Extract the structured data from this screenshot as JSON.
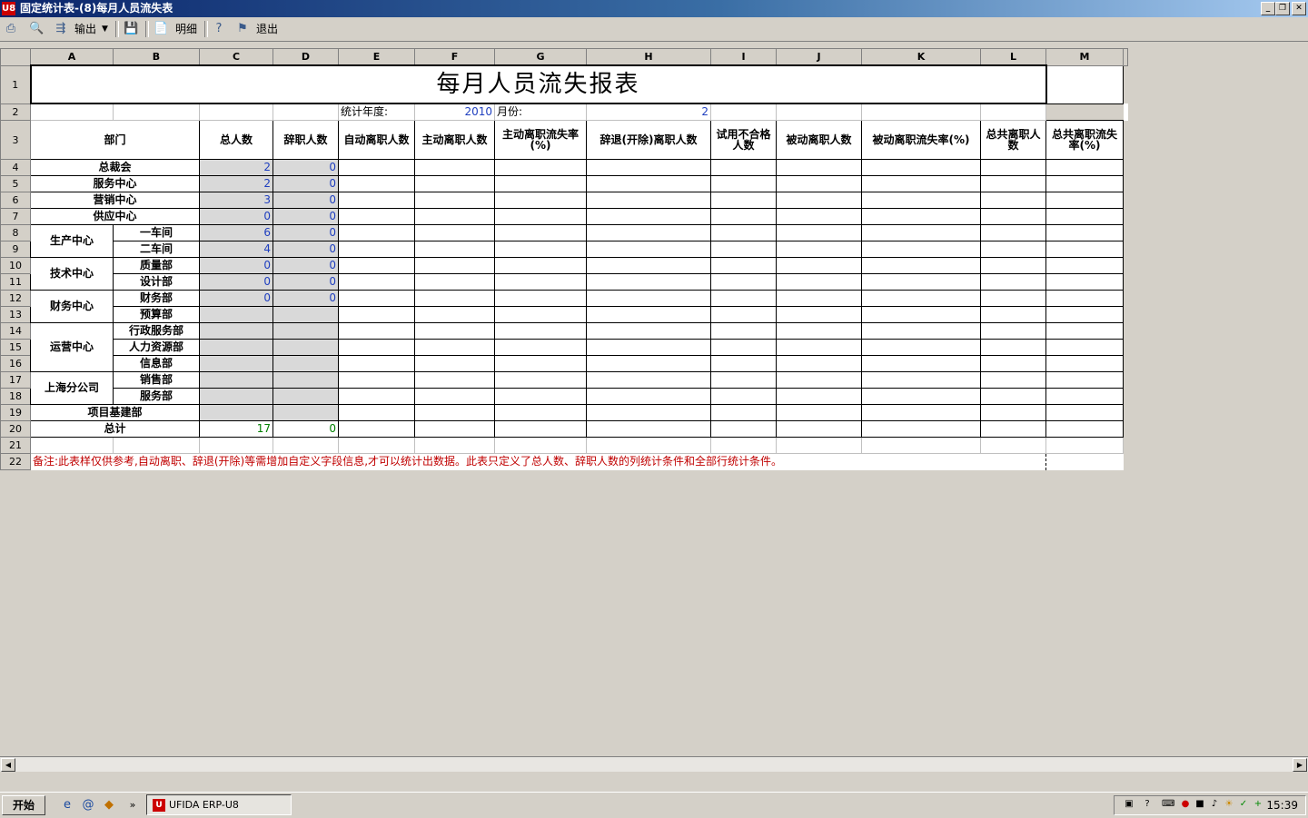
{
  "window": {
    "title": "固定统计表-(8)每月人员流失表",
    "app_icon": "U8",
    "minimize": "_",
    "restore": "❐",
    "close": "✕"
  },
  "toolbar": {
    "export_label": "输出",
    "detail_label": "明细",
    "exit_label": "退出"
  },
  "columns": [
    "A",
    "B",
    "C",
    "D",
    "E",
    "F",
    "G",
    "H",
    "I",
    "J",
    "K",
    "L",
    "M"
  ],
  "row_numbers": [
    "1",
    "2",
    "3",
    "4",
    "5",
    "6",
    "7",
    "8",
    "9",
    "10",
    "11",
    "12",
    "13",
    "14",
    "15",
    "16",
    "17",
    "18",
    "19",
    "20",
    "21",
    "22"
  ],
  "report": {
    "title": "每月人员流失报表",
    "year_label": "统计年度:",
    "year_value": "2010",
    "month_label": "月份:",
    "month_value": "2",
    "headers": {
      "dept": "部门",
      "total": "总人数",
      "resigned": "辞职人数",
      "auto_leave": "自动离职人数",
      "active_leave": "主动离职人数",
      "active_rate": "主动离职流失率(%)",
      "dismissed": "辞退(开除)离职人数",
      "probation_fail": "试用不合格人数",
      "passive_leave": "被动离职人数",
      "passive_rate": "被动离职流失率(%)",
      "total_leave": "总共离职人数",
      "total_rate": "总共离职流失率(%)"
    },
    "rows": [
      {
        "group": "总裁会",
        "sub": "",
        "total": "2",
        "resigned": "0"
      },
      {
        "group": "服务中心",
        "sub": "",
        "total": "2",
        "resigned": "0"
      },
      {
        "group": "营销中心",
        "sub": "",
        "total": "3",
        "resigned": "0"
      },
      {
        "group": "供应中心",
        "sub": "",
        "total": "0",
        "resigned": "0"
      },
      {
        "group": "生产中心",
        "sub": "一车间",
        "total": "6",
        "resigned": "0"
      },
      {
        "group": "",
        "sub": "二车间",
        "total": "4",
        "resigned": "0"
      },
      {
        "group": "技术中心",
        "sub": "质量部",
        "total": "0",
        "resigned": "0"
      },
      {
        "group": "",
        "sub": "设计部",
        "total": "0",
        "resigned": "0"
      },
      {
        "group": "财务中心",
        "sub": "财务部",
        "total": "0",
        "resigned": "0"
      },
      {
        "group": "",
        "sub": "预算部",
        "total": "",
        "resigned": ""
      },
      {
        "group": "运营中心",
        "sub": "行政服务部",
        "total": "",
        "resigned": ""
      },
      {
        "group": "",
        "sub": "人力资源部",
        "total": "",
        "resigned": ""
      },
      {
        "group": "",
        "sub": "信息部",
        "total": "",
        "resigned": ""
      },
      {
        "group": "上海分公司",
        "sub": "销售部",
        "total": "",
        "resigned": ""
      },
      {
        "group": "",
        "sub": "服务部",
        "total": "",
        "resigned": ""
      },
      {
        "group": "项目基建部",
        "sub": "",
        "total": "",
        "resigned": ""
      }
    ],
    "sum_label": "总计",
    "sum_total": "17",
    "sum_resigned": "0",
    "note": "备注:此表样仅供参考,自动离职、辞退(开除)等需增加自定义字段信息,才可以统计出数据。此表只定义了总人数、辞职人数的列统计条件和全部行统计条件。"
  },
  "taskbar": {
    "start_label": "开始",
    "task_label": "UFIDA ERP-U8",
    "clock": "15:39",
    "more": "»"
  }
}
